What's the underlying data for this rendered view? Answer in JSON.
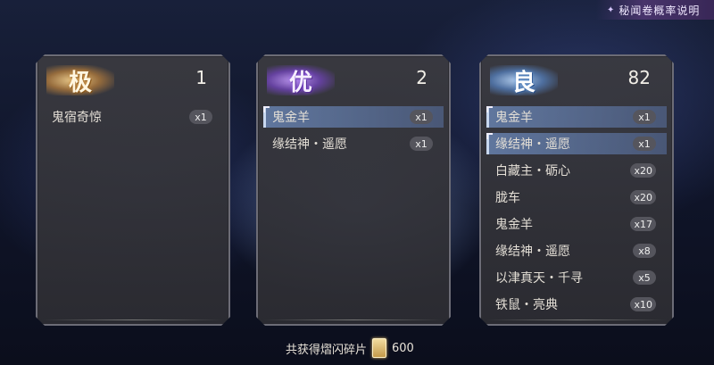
{
  "top_link": {
    "label": "秘闻卷概率说明",
    "icon": "sparkle-icon"
  },
  "cards": [
    {
      "grade": "极",
      "count": "1",
      "rows": [
        {
          "name": "鬼宿奇惊",
          "qty": "x1",
          "highlight": false
        }
      ]
    },
    {
      "grade": "优",
      "count": "2",
      "rows": [
        {
          "name": "鬼金羊",
          "qty": "x1",
          "highlight": true
        },
        {
          "name": "缘结神・遥愿",
          "qty": "x1",
          "highlight": false
        }
      ]
    },
    {
      "grade": "良",
      "count": "82",
      "rows": [
        {
          "name": "鬼金羊",
          "qty": "x1",
          "highlight": true
        },
        {
          "name": "缘结神・遥愿",
          "qty": "x1",
          "highlight": true
        },
        {
          "name": "白藏主・砺心",
          "qty": "x20",
          "highlight": false
        },
        {
          "name": "胧车",
          "qty": "x20",
          "highlight": false
        },
        {
          "name": "鬼金羊",
          "qty": "x17",
          "highlight": false
        },
        {
          "name": "缘结神・遥愿",
          "qty": "x8",
          "highlight": false
        },
        {
          "name": "以津真天・千寻",
          "qty": "x5",
          "highlight": false
        },
        {
          "name": "铁鼠・亮典",
          "qty": "x10",
          "highlight": false
        }
      ]
    }
  ],
  "footer": {
    "label": "共获得熠闪碎片",
    "amount": "600",
    "icon": "fragment-icon"
  }
}
